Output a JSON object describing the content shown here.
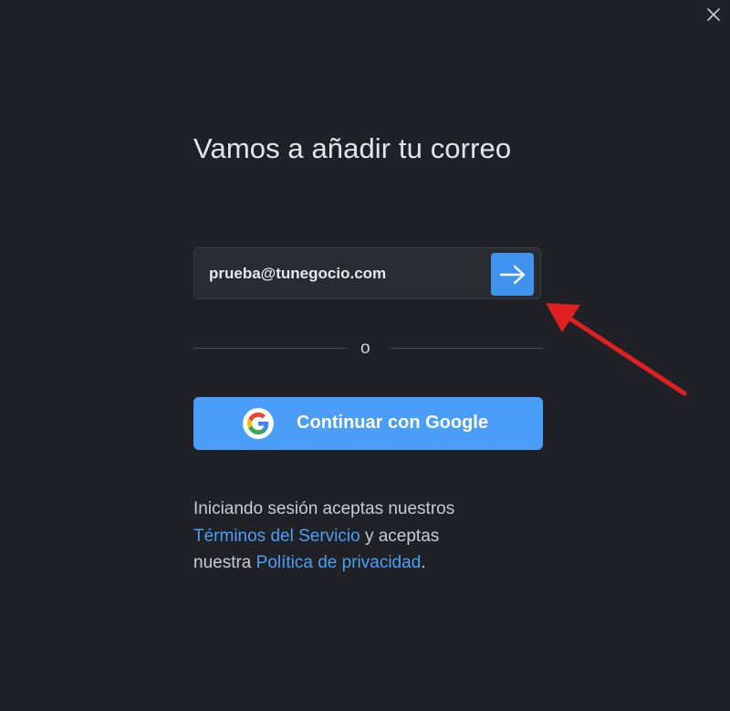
{
  "window": {
    "close_icon": "close-icon"
  },
  "signin": {
    "title": "Vamos a añadir tu correo",
    "email_value": "prueba@tunegocio.com",
    "email_placeholder": "",
    "submit_icon": "arrow-right-icon",
    "divider_text": "o",
    "google_button_label": "Continuar con Google",
    "google_icon": "google-logo-icon"
  },
  "legal": {
    "line1": "Iniciando sesión aceptas nuestros",
    "terms_link": "Términos del Servicio",
    "mid_text": " y aceptas",
    "prefix_text": "nuestra ",
    "privacy_link": "Política de privacidad",
    "suffix_text": "."
  },
  "annotation": {
    "icon": "red-arrow-annotation",
    "color": "#e02020"
  },
  "colors": {
    "background": "#202126",
    "accent": "#4a9df8",
    "submit_button": "#3f93ee",
    "link": "#4b9ff5"
  }
}
